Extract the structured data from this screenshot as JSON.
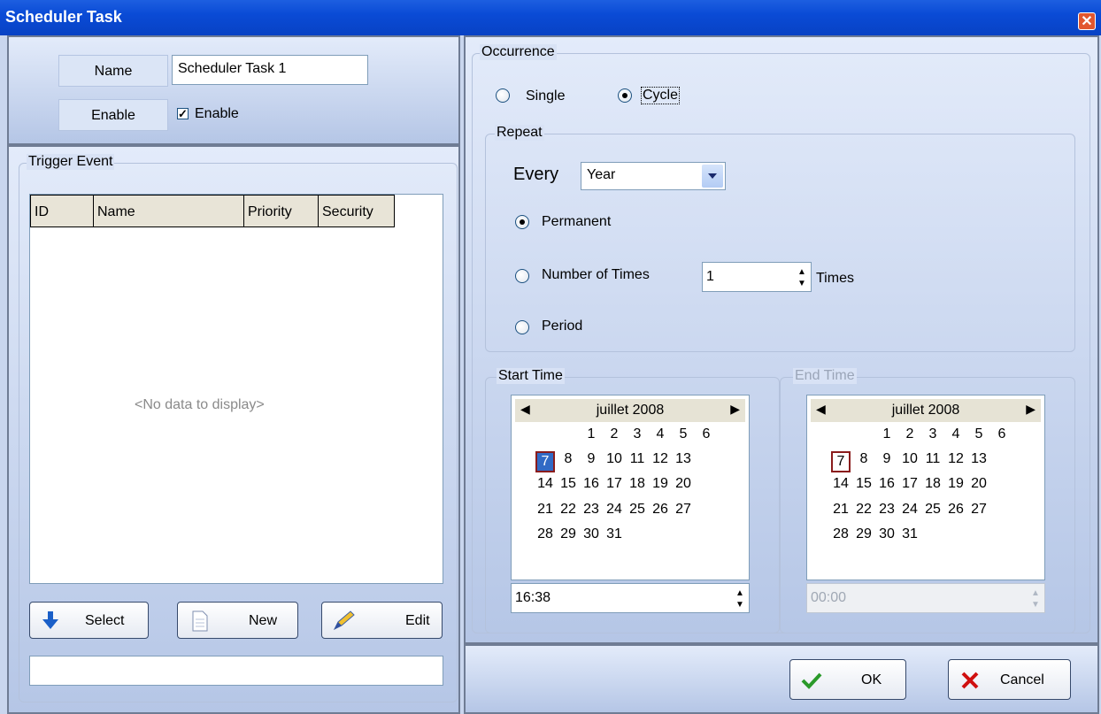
{
  "window": {
    "title": "Scheduler Task",
    "close_icon": "close-icon"
  },
  "general": {
    "name_label": "Name",
    "name_value": "Scheduler Task 1",
    "enable_label": "Enable",
    "enable_checkbox_label": "Enable",
    "enable_checked": true
  },
  "trigger": {
    "group_label": "Trigger Event",
    "columns": [
      "ID",
      "Name",
      "Priority",
      "Security"
    ],
    "empty_text": "<No data to display>",
    "buttons": {
      "select": "Select",
      "new": "New",
      "edit": "Edit"
    },
    "status_value": ""
  },
  "occurrence": {
    "group_label": "Occurrence",
    "single_label": "Single",
    "cycle_label": "Cycle",
    "selected": "Cycle"
  },
  "repeat": {
    "group_label": "Repeat",
    "every_label": "Every",
    "every_value": "Year",
    "permanent_label": "Permanent",
    "number_of_times_label": "Number of Times",
    "times_value": "1",
    "times_label": "Times",
    "period_label": "Period",
    "selected": "Permanent"
  },
  "start_time": {
    "group_label": "Start Time",
    "month": "juillet 2008",
    "selected_day": "7",
    "weeks": [
      [
        "",
        "",
        "",
        "1",
        "2",
        "3",
        "4",
        "5",
        "6"
      ],
      [
        "",
        "7",
        "8",
        "9",
        "10",
        "11",
        "12",
        "13"
      ],
      [
        "14",
        "15",
        "16",
        "17",
        "18",
        "19",
        "20"
      ],
      [
        "21",
        "22",
        "23",
        "24",
        "25",
        "26",
        "27"
      ],
      [
        "28",
        "29",
        "30",
        "31"
      ]
    ],
    "time": "16:38"
  },
  "end_time": {
    "group_label": "End Time",
    "month": "juillet 2008",
    "selected_day": "7",
    "time": "00:00"
  },
  "footer": {
    "ok": "OK",
    "cancel": "Cancel"
  },
  "colors": {
    "title_bar": "#0a4bd6",
    "selected_day": "#316ac5",
    "ok_check": "#2a9a2a",
    "cancel_x": "#d01010"
  }
}
